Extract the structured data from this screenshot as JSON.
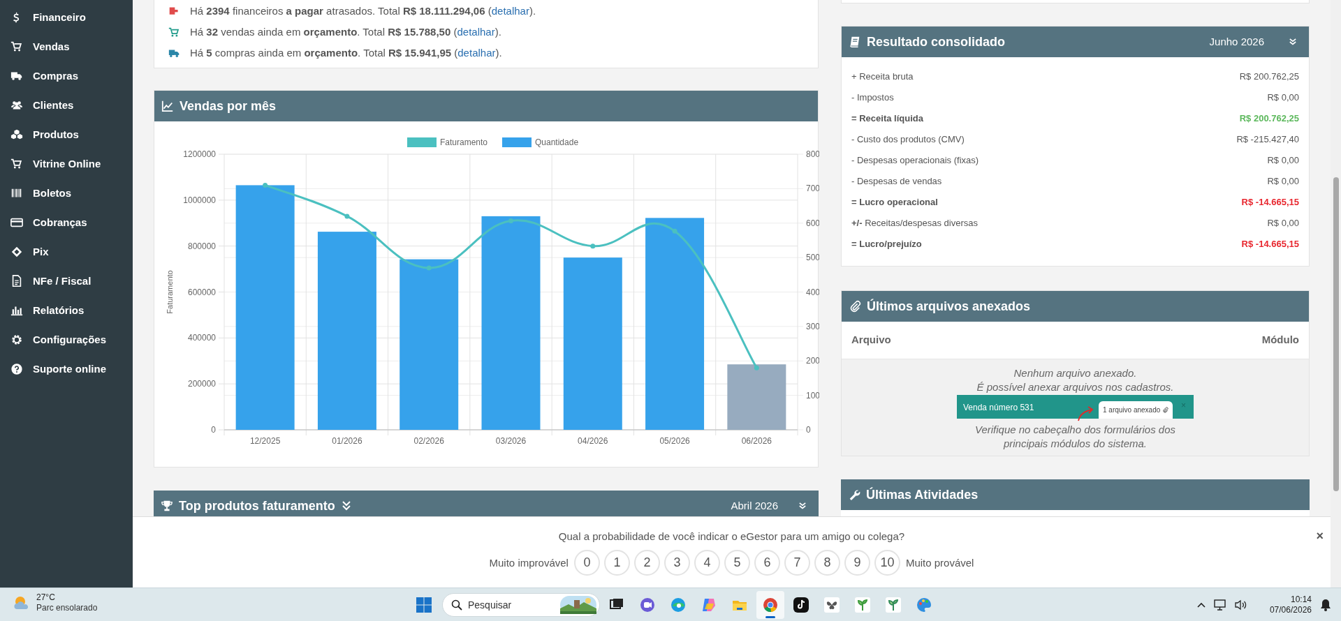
{
  "sidebar": {
    "items": [
      {
        "label": "Financeiro"
      },
      {
        "label": "Vendas"
      },
      {
        "label": "Compras"
      },
      {
        "label": "Clientes"
      },
      {
        "label": "Produtos"
      },
      {
        "label": "Vitrine Online"
      },
      {
        "label": "Boletos"
      },
      {
        "label": "Cobranças"
      },
      {
        "label": "Pix"
      },
      {
        "label": "NFe / Fiscal"
      },
      {
        "label": "Relatórios"
      },
      {
        "label": "Configurações"
      },
      {
        "label": "Suporte online"
      }
    ]
  },
  "alerts": [
    {
      "color": "#e04b4b",
      "before": "Há **2394** financeiros **a pagar** atrasados. Total **R$ 18.111.294,06** (",
      "link": "detalhar",
      "after": ")."
    },
    {
      "color": "#1f9a8a",
      "before": "Há **32** vendas ainda em **orçamento**. Total **R$ 15.788,50** (",
      "link": "detalhar",
      "after": ")."
    },
    {
      "color": "#2a86a8",
      "before": "Há **5** compras ainda em **orçamento**. Total **R$ 15.941,95** (",
      "link": "detalhar",
      "after": ")."
    }
  ],
  "sales_chart": {
    "title": "Vendas por mês",
    "chart_data": {
      "type": "bar",
      "ylabel": "Faturamento",
      "categories": [
        "12/2025",
        "01/2026",
        "02/2026",
        "03/2026",
        "04/2026",
        "05/2026",
        "06/2026"
      ],
      "grid": true,
      "legend": true,
      "series": [
        {
          "name": "Faturamento",
          "type": "line",
          "marker": true,
          "axis": "y",
          "color": "#4bc0c0",
          "values": [
            1065000,
            930000,
            705000,
            910000,
            800000,
            865000,
            270000
          ]
        },
        {
          "name": "Quantidade",
          "axis": "y2",
          "color": "#36a2eb",
          "colors": [
            "#36a2eb",
            "#36a2eb",
            "#36a2eb",
            "#36a2eb",
            "#36a2eb",
            "#36a2eb",
            "#97abbf"
          ],
          "values": [
            710,
            575,
            495,
            620,
            500,
            615,
            190
          ]
        }
      ],
      "ylim": [
        0,
        1200000
      ],
      "yticks": [
        0,
        200000,
        400000,
        600000,
        800000,
        1000000,
        1200000
      ],
      "y2lim": [
        0,
        800
      ],
      "y2ticks": [
        0,
        100,
        200,
        300,
        400,
        500,
        600,
        700,
        800
      ]
    }
  },
  "top_products": {
    "title": "Top produtos faturamento",
    "period": "Abril 2026"
  },
  "result": {
    "title": "Resultado consolidado",
    "period": "Junho 2026",
    "rows": [
      {
        "label": "+ Receita bruta",
        "value": "R$ 200.762,25",
        "kind": "plain"
      },
      {
        "label": "- Impostos",
        "value": "R$ 0,00",
        "kind": "plain"
      },
      {
        "label": "= Receita líquida",
        "value": "R$ 200.762,25",
        "kind": "positive"
      },
      {
        "label": "- Custo dos produtos (CMV)",
        "value": "R$ -215.427,40",
        "kind": "plain"
      },
      {
        "label": "- Despesas operacionais (fixas)",
        "value": "R$ 0,00",
        "kind": "plain"
      },
      {
        "label": "- Despesas de vendas",
        "value": "R$ 0,00",
        "kind": "plain"
      },
      {
        "label": "= Lucro operacional",
        "value": "R$ -14.665,15",
        "kind": "negative"
      },
      {
        "label": "**+/-** Receitas/despesas diversas",
        "value": "R$ 0,00",
        "kind": "plain"
      },
      {
        "label": "= Lucro/prejuízo",
        "value": "R$ -14.665,15",
        "kind": "negative"
      }
    ]
  },
  "attachments": {
    "title": "Últimos arquivos anexados",
    "columns": [
      "Arquivo",
      "Módulo"
    ],
    "empty_lines": [
      "Nenhum arquivo anexado.",
      "É possível anexar arquivos nos cadastros."
    ],
    "example": {
      "title": "Venda número 531",
      "tab": "1 arquivo anexado",
      "close": "×"
    },
    "hint_lines": [
      "Verifique no cabeçalho dos formulários dos",
      "principais módulos do sistema."
    ]
  },
  "activities": {
    "title": "Últimas Atividades"
  },
  "survey": {
    "question": "Qual a probabilidade de você indicar o eGestor para um amigo ou colega?",
    "low_label": "Muito improvável",
    "scores": [
      "0",
      "1",
      "2",
      "3",
      "4",
      "5",
      "6",
      "7",
      "8",
      "9",
      "10"
    ],
    "high_label": "Muito provável",
    "close": "×"
  },
  "taskbar": {
    "weather": {
      "temp": "27°C",
      "desc": "Parc ensolarado"
    },
    "search": {
      "placeholder": "Pesquisar"
    },
    "apps": [
      {
        "selected": false
      },
      {
        "selected": false
      },
      {
        "selected": false
      },
      {
        "selected": false
      },
      {
        "selected": false
      },
      {
        "selected": true
      },
      {
        "selected": false
      },
      {
        "selected": false
      },
      {
        "selected": false
      },
      {
        "selected": false
      },
      {
        "selected": false
      }
    ],
    "clock": {
      "time": "10:14",
      "date": "07/06/2026"
    }
  }
}
